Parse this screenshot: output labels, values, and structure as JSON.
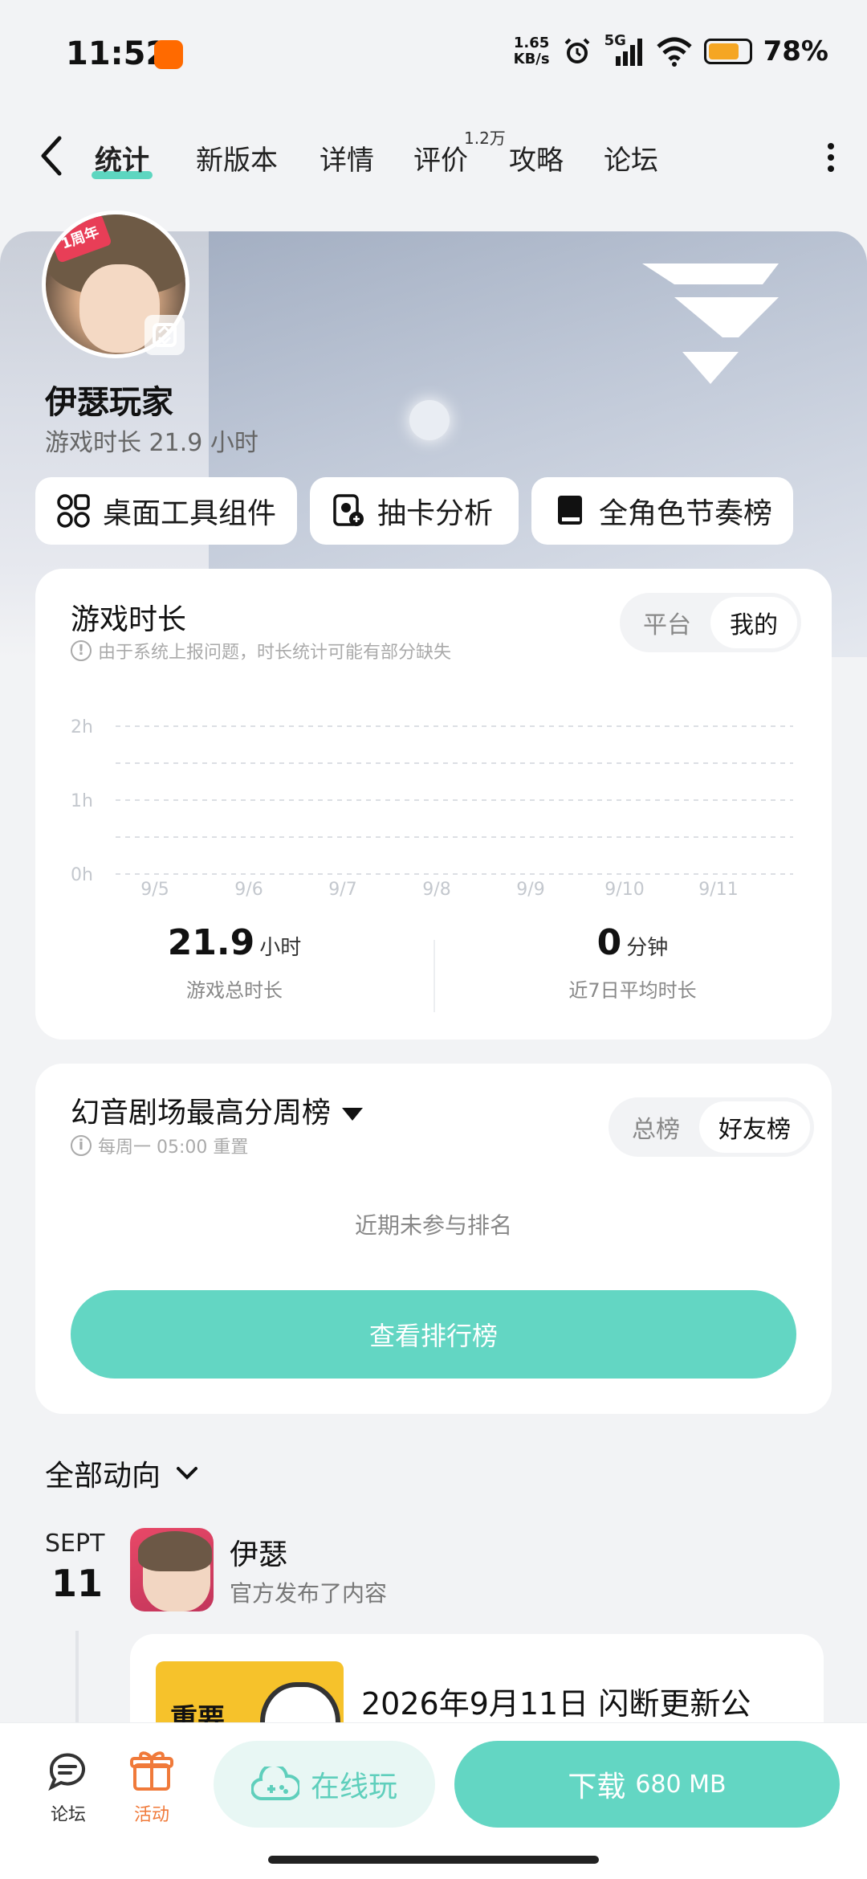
{
  "status_bar": {
    "time": "11:52",
    "net_speed_value": "1.65",
    "net_speed_unit": "KB/s",
    "network": "5G",
    "battery_percent": "78%",
    "battery_level": 0.78
  },
  "nav": {
    "tabs": [
      {
        "label": "统计",
        "active": true
      },
      {
        "label": "新版本",
        "active": false
      },
      {
        "label": "详情",
        "active": false
      },
      {
        "label": "评价",
        "active": false
      },
      {
        "label": "攻略",
        "active": false
      },
      {
        "label": "论坛",
        "active": false
      }
    ],
    "review_count_badge": "1.2万"
  },
  "profile": {
    "avatar_badge": "1周年",
    "username": "伊瑟玩家",
    "playtime": "游戏时长 21.9 小时"
  },
  "quick_actions": [
    {
      "label": "桌面工具组件",
      "icon": "widget-grid-icon"
    },
    {
      "label": "抽卡分析",
      "icon": "gacha-analysis-icon"
    },
    {
      "label": "全角色节奏榜",
      "icon": "book-icon"
    }
  ],
  "playtime_card": {
    "title": "游戏时长",
    "note": "由于系统上报问题，时长统计可能有部分缺失",
    "toggle": [
      {
        "label": "平台",
        "selected": false
      },
      {
        "label": "我的",
        "selected": true
      }
    ],
    "total_value": "21.9",
    "total_unit": "小时",
    "total_label": "游戏总时长",
    "avg_value": "0",
    "avg_unit": "分钟",
    "avg_label": "近7日平均时长"
  },
  "chart_data": {
    "type": "bar",
    "categories": [
      "9/5",
      "9/6",
      "9/7",
      "9/8",
      "9/9",
      "9/10",
      "9/11"
    ],
    "values": [
      0,
      0,
      0,
      0,
      0,
      0,
      0
    ],
    "y_ticks": [
      "0h",
      "1h",
      "2h"
    ],
    "ylim": [
      0,
      2
    ],
    "grid": true
  },
  "leaderboard_card": {
    "title": "幻音剧场最高分周榜",
    "note": "每周一 05:00 重置",
    "toggle": [
      {
        "label": "总榜",
        "selected": false
      },
      {
        "label": "好友榜",
        "selected": true
      }
    ],
    "empty_message": "近期未参与排名",
    "button_label": "查看排行榜"
  },
  "feed": {
    "filter_label": "全部动向",
    "date_month": "SEPT",
    "date_day": "11",
    "author": "伊瑟",
    "action": "官方发布了内容",
    "post_thumb_text": "重要",
    "post_title": "2026年9月11日 闪断更新公"
  },
  "bottom_bar": {
    "forum_label": "论坛",
    "activity_label": "活动",
    "online_play_label": "在线玩",
    "download_label": "下载",
    "download_size": "680 MB"
  },
  "colors": {
    "accent": "#63d6c3",
    "accent_light": "#e8f7f4",
    "activity": "#f07a3a",
    "background": "#f2f3f5"
  }
}
